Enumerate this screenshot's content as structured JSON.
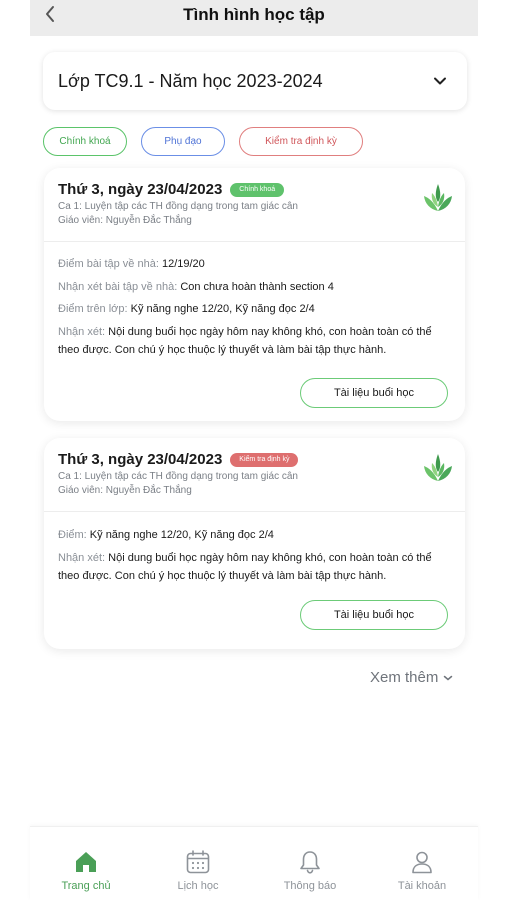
{
  "header": {
    "title": "Tình hình học tập",
    "back_icon": "chevron-left-icon"
  },
  "class_select": {
    "value": "Lớp TC9.1 - Năm học 2023-2024",
    "icon": "chevron-down-icon"
  },
  "filters": [
    {
      "label": "Chính khoá",
      "color": "#41a64f"
    },
    {
      "label": "Phụ đạo",
      "color": "#4f73d6"
    },
    {
      "label": "Kiểm tra định kỳ",
      "color": "#d0565a"
    }
  ],
  "cards": [
    {
      "date": "Thứ 3, ngày 23/04/2023",
      "tag": "Chính khoá",
      "lesson": "Ca 1: Luyện tập các TH đồng dạng trong tam giác cân",
      "teacher": "Giáo viên: Nguyễn Đắc Thắng",
      "lines": [
        {
          "label": "Điểm bài tập về nhà:",
          "value": "12/19/20"
        },
        {
          "label": "Nhận xét bài tập về nhà:",
          "value": "Con chưa hoàn thành section 4"
        },
        {
          "label": "Điểm trên lớp:",
          "value": "Kỹ năng nghe 12/20, Kỹ năng đọc 2/4"
        },
        {
          "label": "Nhận xét:",
          "value": "Nội dung buổi học ngày hôm nay không khó, con hoàn toàn có thể theo được. Con chú ý học thuộc lý thuyết và làm bài tập thực hành."
        }
      ],
      "button": "Tài liệu buổi học"
    },
    {
      "date": "Thứ 3, ngày 23/04/2023",
      "tag": "Kiểm tra định kỳ",
      "lesson": "Ca 1: Luyện tập các TH đồng dạng trong tam giác cân",
      "teacher": "Giáo viên: Nguyễn Đắc Thắng",
      "lines": [
        {
          "label": "Điểm:",
          "value": "Kỹ năng nghe 12/20, Kỹ năng đọc 2/4"
        },
        {
          "label": "Nhận xét:",
          "value": "Nội dung buổi học ngày hôm nay không khó, con hoàn toàn có thể theo được. Con chú ý học thuộc lý thuyết và làm bài tập thực hành."
        }
      ],
      "button": "Tài liệu buổi học"
    }
  ],
  "see_more": "Xem thêm",
  "tabs": [
    {
      "label": "Trang chủ",
      "icon": "home-icon",
      "active": true
    },
    {
      "label": "Lịch học",
      "icon": "calendar-icon",
      "active": false
    },
    {
      "label": "Thông báo",
      "icon": "bell-icon",
      "active": false
    },
    {
      "label": "Tài khoản",
      "icon": "user-icon",
      "active": false
    }
  ],
  "colors": {
    "brand_green": "#4a9f57",
    "tag_green": "#5fc26c",
    "tag_red": "#de6f6f"
  }
}
